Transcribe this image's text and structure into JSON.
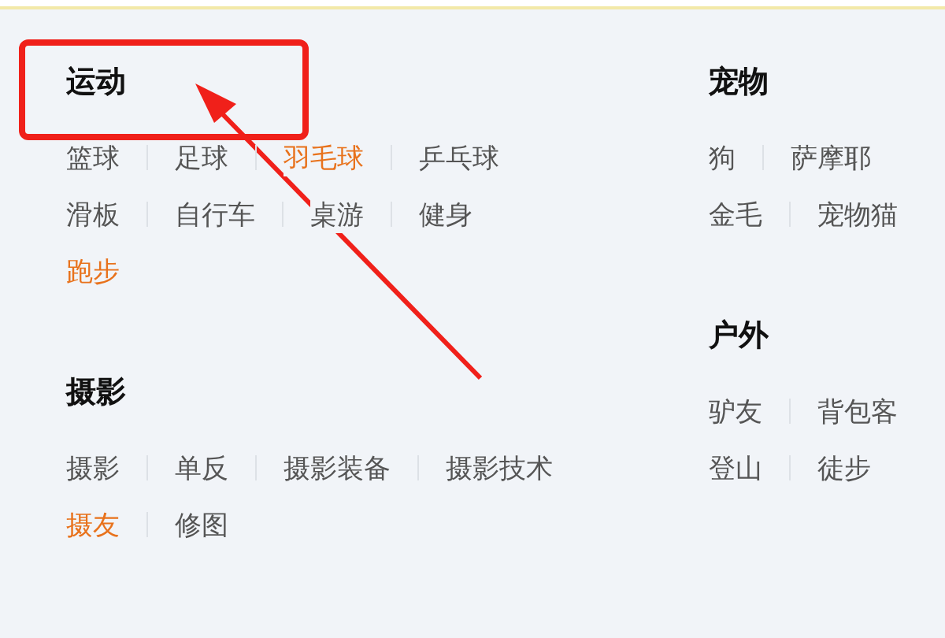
{
  "columns": [
    {
      "sections": [
        {
          "title": "运动",
          "rows": [
            [
              {
                "label": "篮球",
                "hot": false
              },
              {
                "label": "足球",
                "hot": false
              },
              {
                "label": "羽毛球",
                "hot": true
              },
              {
                "label": "乒乓球",
                "hot": false
              }
            ],
            [
              {
                "label": "滑板",
                "hot": false
              },
              {
                "label": "自行车",
                "hot": false
              },
              {
                "label": "桌游",
                "hot": false
              },
              {
                "label": "健身",
                "hot": false
              }
            ],
            [
              {
                "label": "跑步",
                "hot": true
              }
            ]
          ]
        },
        {
          "title": "摄影",
          "rows": [
            [
              {
                "label": "摄影",
                "hot": false
              },
              {
                "label": "单反",
                "hot": false
              },
              {
                "label": "摄影装备",
                "hot": false
              },
              {
                "label": "摄影技术",
                "hot": false
              }
            ],
            [
              {
                "label": "摄友",
                "hot": true
              },
              {
                "label": "修图",
                "hot": false
              }
            ]
          ]
        }
      ]
    },
    {
      "sections": [
        {
          "title": "宠物",
          "rows": [
            [
              {
                "label": "狗",
                "hot": false
              },
              {
                "label": "萨摩耶",
                "hot": false
              }
            ],
            [
              {
                "label": "金毛",
                "hot": false
              },
              {
                "label": "宠物猫",
                "hot": false
              }
            ]
          ]
        },
        {
          "title": "户外",
          "rows": [
            [
              {
                "label": "驴友",
                "hot": false
              },
              {
                "label": "背包客",
                "hot": false
              }
            ],
            [
              {
                "label": "登山",
                "hot": false
              },
              {
                "label": "徒步",
                "hot": false
              }
            ]
          ]
        }
      ]
    }
  ]
}
